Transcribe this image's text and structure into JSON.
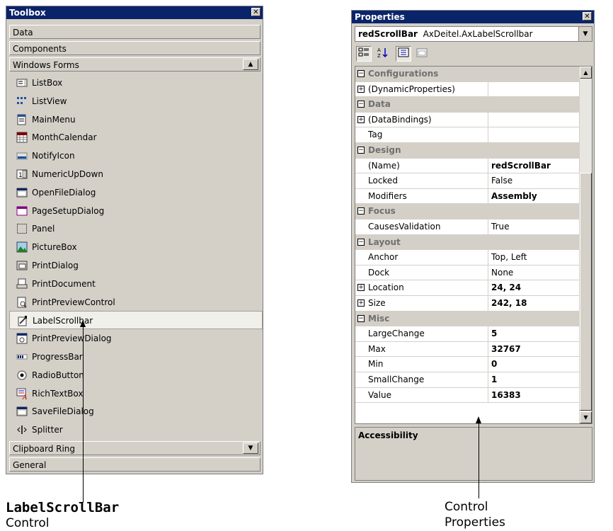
{
  "toolbox": {
    "title": "Toolbox",
    "close_glyph": "✕",
    "tabs_top": [
      "Data",
      "Components",
      "Windows Forms"
    ],
    "scroll_up_glyph": "▲",
    "scroll_down_glyph": "▼",
    "items": [
      {
        "label": "ListBox",
        "icon": "listbox-icon"
      },
      {
        "label": "ListView",
        "icon": "listview-icon"
      },
      {
        "label": "MainMenu",
        "icon": "mainmenu-icon"
      },
      {
        "label": "MonthCalendar",
        "icon": "monthcalendar-icon"
      },
      {
        "label": "NotifyIcon",
        "icon": "notifyicon-icon"
      },
      {
        "label": "NumericUpDown",
        "icon": "numericupdown-icon"
      },
      {
        "label": "OpenFileDialog",
        "icon": "openfiledialog-icon"
      },
      {
        "label": "PageSetupDialog",
        "icon": "pagesetupdialog-icon"
      },
      {
        "label": "Panel",
        "icon": "panel-icon"
      },
      {
        "label": "PictureBox",
        "icon": "picturebox-icon"
      },
      {
        "label": "PrintDialog",
        "icon": "printdialog-icon"
      },
      {
        "label": "PrintDocument",
        "icon": "printdocument-icon"
      },
      {
        "label": "PrintPreviewControl",
        "icon": "printpreviewcontrol-icon"
      },
      {
        "label": "LabelScrollbar",
        "icon": "labelscrollbar-icon",
        "selected": true
      },
      {
        "label": "PrintPreviewDialog",
        "icon": "printpreviewdialog-icon"
      },
      {
        "label": "ProgressBar",
        "icon": "progressbar-icon"
      },
      {
        "label": "RadioButton",
        "icon": "radiobutton-icon"
      },
      {
        "label": "RichTextBox",
        "icon": "richtextbox-icon"
      },
      {
        "label": "SaveFileDialog",
        "icon": "savefiledialog-icon"
      },
      {
        "label": "Splitter",
        "icon": "splitter-icon"
      }
    ],
    "tabs_bottom": [
      "Clipboard Ring",
      "General"
    ]
  },
  "properties": {
    "title": "Properties",
    "close_glyph": "✕",
    "object_name": "redScrollBar",
    "object_type": "AxDeitel.AxLabelScrollbar",
    "dropdown_glyph": "▼",
    "rows": [
      {
        "cat": true,
        "name": "Configurations",
        "exp": "⊟"
      },
      {
        "name": "(DynamicProperties)",
        "value": "",
        "exp": "⊞"
      },
      {
        "cat": true,
        "name": "Data",
        "exp": "⊟"
      },
      {
        "name": "(DataBindings)",
        "value": "",
        "exp": "⊞"
      },
      {
        "name": "Tag",
        "value": ""
      },
      {
        "cat": true,
        "name": "Design",
        "exp": "⊟"
      },
      {
        "name": "(Name)",
        "value": "redScrollBar",
        "bold": true
      },
      {
        "name": "Locked",
        "value": "False"
      },
      {
        "name": "Modifiers",
        "value": "Assembly",
        "bold": true
      },
      {
        "cat": true,
        "name": "Focus",
        "exp": "⊟"
      },
      {
        "name": "CausesValidation",
        "value": "True"
      },
      {
        "cat": true,
        "name": "Layout",
        "exp": "⊟"
      },
      {
        "name": "Anchor",
        "value": "Top, Left"
      },
      {
        "name": "Dock",
        "value": "None"
      },
      {
        "name": "Location",
        "value": "24, 24",
        "bold": true,
        "exp": "⊞"
      },
      {
        "name": "Size",
        "value": "242, 18",
        "bold": true,
        "exp": "⊞"
      },
      {
        "cat": true,
        "name": "Misc",
        "exp": "⊟"
      },
      {
        "name": "LargeChange",
        "value": "5",
        "bold": true
      },
      {
        "name": "Max",
        "value": "32767",
        "bold": true
      },
      {
        "name": "Min",
        "value": "0",
        "bold": true
      },
      {
        "name": "SmallChange",
        "value": "1",
        "bold": true
      },
      {
        "name": "Value",
        "value": "16383",
        "bold": true
      }
    ],
    "description_title": "Accessibility"
  },
  "captions": {
    "left_line1": "LabelScrollBar",
    "left_line2": "Control",
    "right_line1": "Control",
    "right_line2": "Properties"
  }
}
